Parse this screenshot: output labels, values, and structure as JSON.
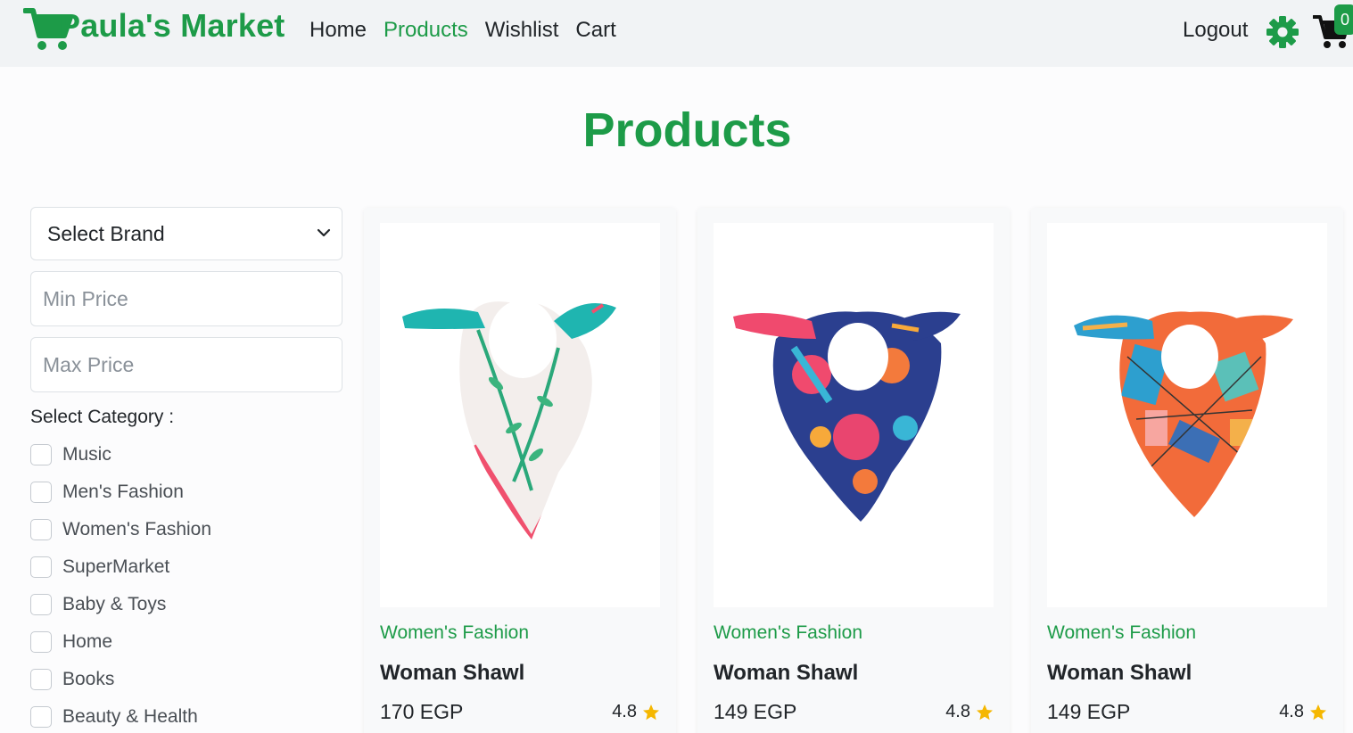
{
  "navbar": {
    "brand_name": "Paula's Market",
    "links": [
      "Home",
      "Products",
      "Wishlist",
      "Cart"
    ],
    "active_link": "Products",
    "logout_label": "Logout",
    "cart_count": "0",
    "brand_color": "#1d9b48"
  },
  "page": {
    "title": "Products"
  },
  "filters": {
    "brand_select": "Select Brand",
    "min_price_placeholder": "Min Price",
    "max_price_placeholder": "Max Price",
    "category_label": "Select Category :",
    "categories": [
      "Music",
      "Men's Fashion",
      "Women's Fashion",
      "SuperMarket",
      "Baby & Toys",
      "Home",
      "Books",
      "Beauty & Health"
    ]
  },
  "products": [
    {
      "category": "Women's Fashion",
      "title": "Woman Shawl",
      "price": "170 EGP",
      "rating": "4.8",
      "image_icon": "floral-scarf-white-teal"
    },
    {
      "category": "Women's Fashion",
      "title": "Woman Shawl",
      "price": "149 EGP",
      "rating": "4.8",
      "image_icon": "floral-scarf-navy-pink"
    },
    {
      "category": "Women's Fashion",
      "title": "Woman Shawl",
      "price": "149 EGP",
      "rating": "4.8",
      "image_icon": "geometric-scarf-orange-blue"
    }
  ],
  "colors": {
    "accent": "#1d9b48",
    "star": "#f5b700",
    "navbar_bg": "#f1f3f5"
  }
}
